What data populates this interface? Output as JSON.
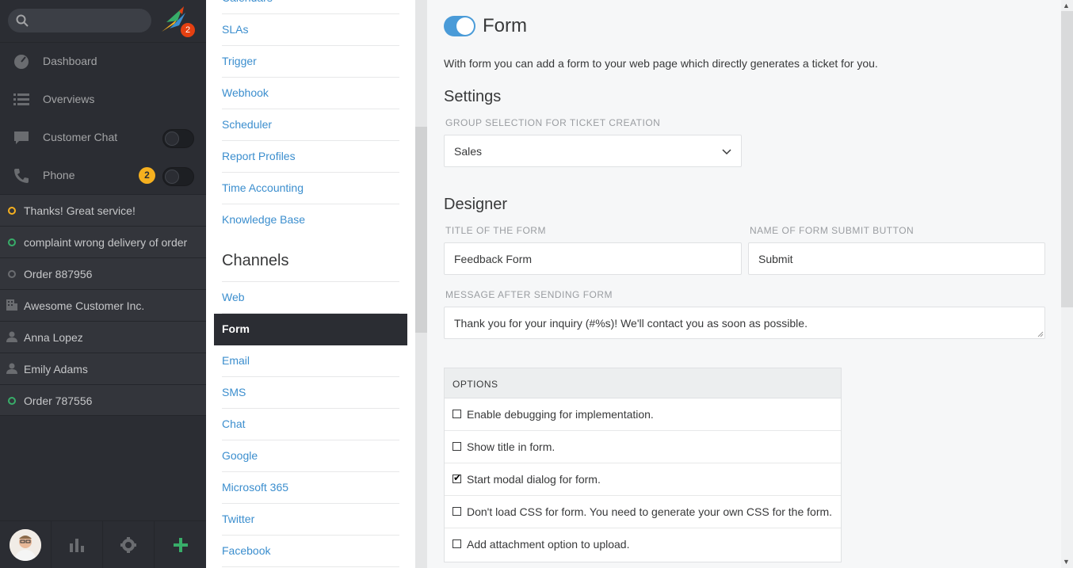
{
  "nav": {
    "search": {
      "placeholder": ""
    },
    "logo_badge": "2",
    "menu": [
      {
        "label": "Dashboard",
        "icon": "dashboard-icon"
      },
      {
        "label": "Overviews",
        "icon": "list-icon"
      },
      {
        "label": "Customer Chat",
        "icon": "chat-icon"
      },
      {
        "label": "Phone",
        "icon": "phone-icon",
        "badge": "2"
      }
    ],
    "tasks": [
      {
        "label": "Thanks! Great service!",
        "icon": "ticket-status-icon",
        "color": "#f6b01f"
      },
      {
        "label": "complaint wrong delivery of order",
        "icon": "ticket-status-icon",
        "color": "#38ad69"
      },
      {
        "label": "Order 887956",
        "icon": "ticket-status-icon",
        "color": "#6a6c70"
      },
      {
        "label": "Awesome Customer Inc.",
        "icon": "organization-icon"
      },
      {
        "label": "Anna Lopez",
        "icon": "user-icon"
      },
      {
        "label": "Emily Adams",
        "icon": "user-icon"
      },
      {
        "label": "Order 787556",
        "icon": "ticket-status-icon",
        "color": "#38ad69"
      }
    ]
  },
  "settings_menu": {
    "items_top": [
      "Calendars",
      "SLAs",
      "Trigger",
      "Webhook",
      "Scheduler",
      "Report Profiles",
      "Time Accounting",
      "Knowledge Base"
    ],
    "channels_heading": "Channels",
    "channels": [
      "Web",
      "Form",
      "Email",
      "SMS",
      "Chat",
      "Google",
      "Microsoft 365",
      "Twitter",
      "Facebook"
    ],
    "active": "Form"
  },
  "main": {
    "title": "Form",
    "description": "With form you can add a form to your web page which directly generates a ticket for you.",
    "settings_heading": "Settings",
    "group_label": "Group selection for Ticket creation",
    "group_value": "Sales",
    "designer_heading": "Designer",
    "title_label": "Title of the form",
    "title_value": "Feedback Form",
    "submit_label": "Name of form submit button",
    "submit_value": "Submit",
    "message_label": "Message after sending form",
    "message_value": "Thank you for your inquiry (#%s)! We'll contact you as soon as possible.",
    "options_heading": "OPTIONS",
    "options": [
      {
        "label": "Enable debugging for implementation.",
        "checked": false
      },
      {
        "label": "Show title in form.",
        "checked": false
      },
      {
        "label": "Start modal dialog for form.",
        "checked": true
      },
      {
        "label": "Don't load CSS for form. You need to generate your own CSS for the form.",
        "checked": false
      },
      {
        "label": "Add attachment option to upload.",
        "checked": false
      }
    ]
  },
  "colors": {
    "accent": "#3b8ece",
    "nav_bg": "#2b2d33",
    "toggle_on": "#4a9bd8",
    "badge_yellow": "#f6b01f",
    "add_green": "#38ad69"
  }
}
